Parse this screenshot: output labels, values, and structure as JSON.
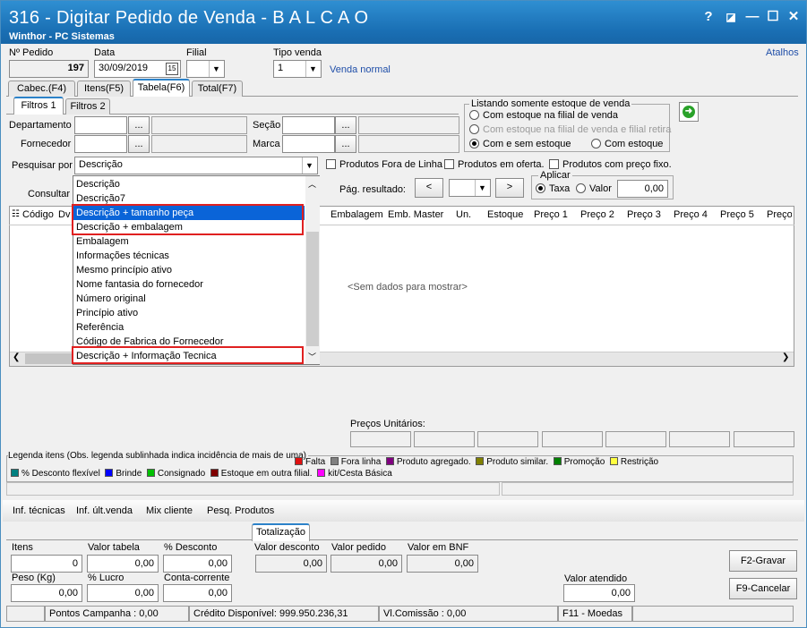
{
  "window": {
    "title": "316 - Digitar Pedido de Venda - B A L C A O",
    "subtitle": "Winthor - PC Sistemas",
    "help": "?",
    "minimize": "—",
    "maximize": "☐",
    "close": "✕"
  },
  "header": {
    "pedido_label": "Nº Pedido",
    "pedido_value": "197",
    "data_label": "Data",
    "data_value": "30/09/2019",
    "filial_label": "Filial",
    "tipo_label": "Tipo venda",
    "tipo_value": "1",
    "tipo_desc": "Venda normal",
    "atalhos": "Atalhos"
  },
  "main_tabs": [
    "Cabec.(F4)",
    "Itens(F5)",
    "Tabela(F6)",
    "Total(F7)"
  ],
  "filter_tabs": [
    "Filtros 1",
    "Filtros 2"
  ],
  "filters": {
    "departamento": "Departamento",
    "fornecedor": "Fornecedor",
    "secao": "Seção",
    "marca": "Marca",
    "ellipsis": "..."
  },
  "estoque": {
    "legend": "Listando somente estoque de venda",
    "opt1": "Com estoque na filial de venda",
    "opt2": "Com estoque na filial de venda e filial retira",
    "opt3": "Com e sem estoque",
    "opt4": "Com estoque"
  },
  "search": {
    "label": "Pesquisar por",
    "value": "Descrição",
    "consultar": "Consultar"
  },
  "checks": {
    "fora_linha": "Produtos Fora de Linha",
    "oferta": "Produtos em oferta.",
    "preco_fixo": "Produtos com preço fixo."
  },
  "pag": {
    "label": "Pág. resultado:",
    "prev": "<",
    "next": ">"
  },
  "aplicar": {
    "legend": "Aplicar",
    "taxa": "Taxa",
    "valor": "Valor",
    "value": "0,00"
  },
  "dropdown_items": [
    "Descrição",
    "Descrição7",
    "Descrição + tamanho peça",
    "Descrição + embalagem",
    "Embalagem",
    "Informações técnicas",
    "Mesmo princípio ativo",
    "Nome fantasia do fornecedor",
    "Número original",
    "Princípio ativo",
    "Referência",
    "Código de Fabrica do Fornecedor",
    "Descrição + Informação Tecnica"
  ],
  "grid": {
    "headers": [
      "Código",
      "Dv",
      "Embalagem",
      "Emb. Master",
      "Un.",
      "Estoque",
      "Preço 1",
      "Preço 2",
      "Preço 3",
      "Preço 4",
      "Preço 5",
      "Preço"
    ],
    "empty": "<Sem dados para mostrar>"
  },
  "precos_unitarios": "Preços Unitários:",
  "legenda": {
    "title": "Legenda itens (Obs. legenda sublinhada indica incidência de mais de uma)",
    "row1": [
      {
        "label": "Falta",
        "color": "#e01010"
      },
      {
        "label": "Fora linha",
        "color": "#808080"
      },
      {
        "label": "Produto agregado.",
        "color": "#800080"
      },
      {
        "label": "Produto similar.",
        "color": "#808000"
      },
      {
        "label": "Promoção",
        "color": "#008000"
      },
      {
        "label": "Restrição",
        "color": "#ffff40"
      }
    ],
    "row2": [
      {
        "label": "% Desconto flexível",
        "color": "#008080"
      },
      {
        "label": "Brinde",
        "color": "#0000ff"
      },
      {
        "label": "Consignado",
        "color": "#00c000"
      },
      {
        "label": "Estoque em outra filial.",
        "color": "#800000"
      },
      {
        "label": "kit/Cesta Básica",
        "color": "#ff00ff"
      }
    ]
  },
  "bottom_links": [
    "Inf. técnicas",
    "Inf. últ.venda",
    "Mix cliente",
    "Pesq. Produtos"
  ],
  "totalizacao": {
    "tab": "Totalização",
    "itens_label": "Itens",
    "itens": "0",
    "valor_tabela_label": "Valor tabela",
    "valor_tabela": "0,00",
    "desconto_label": "% Desconto",
    "desconto": "0,00",
    "peso_label": "Peso (Kg)",
    "peso": "0,00",
    "lucro_label": "% Lucro",
    "lucro": "0,00",
    "conta_label": "Conta-corrente",
    "conta": "0,00",
    "valor_desconto_label": "Valor desconto",
    "valor_desconto": "0,00",
    "valor_pedido_label": "Valor pedido",
    "valor_pedido": "0,00",
    "valor_bnf_label": "Valor em BNF",
    "valor_bnf": "0,00",
    "valor_atendido_label": "Valor atendido",
    "valor_atendido": "0,00"
  },
  "buttons": {
    "gravar": "F2-Gravar",
    "cancelar": "F9-Cancelar"
  },
  "status": {
    "pontos": "Pontos Campanha : 0,00",
    "credito": "Crédito Disponível: 999.950.236,31",
    "comissao": "Vl.Comissão : 0,00",
    "moedas": "F11 - Moedas"
  }
}
